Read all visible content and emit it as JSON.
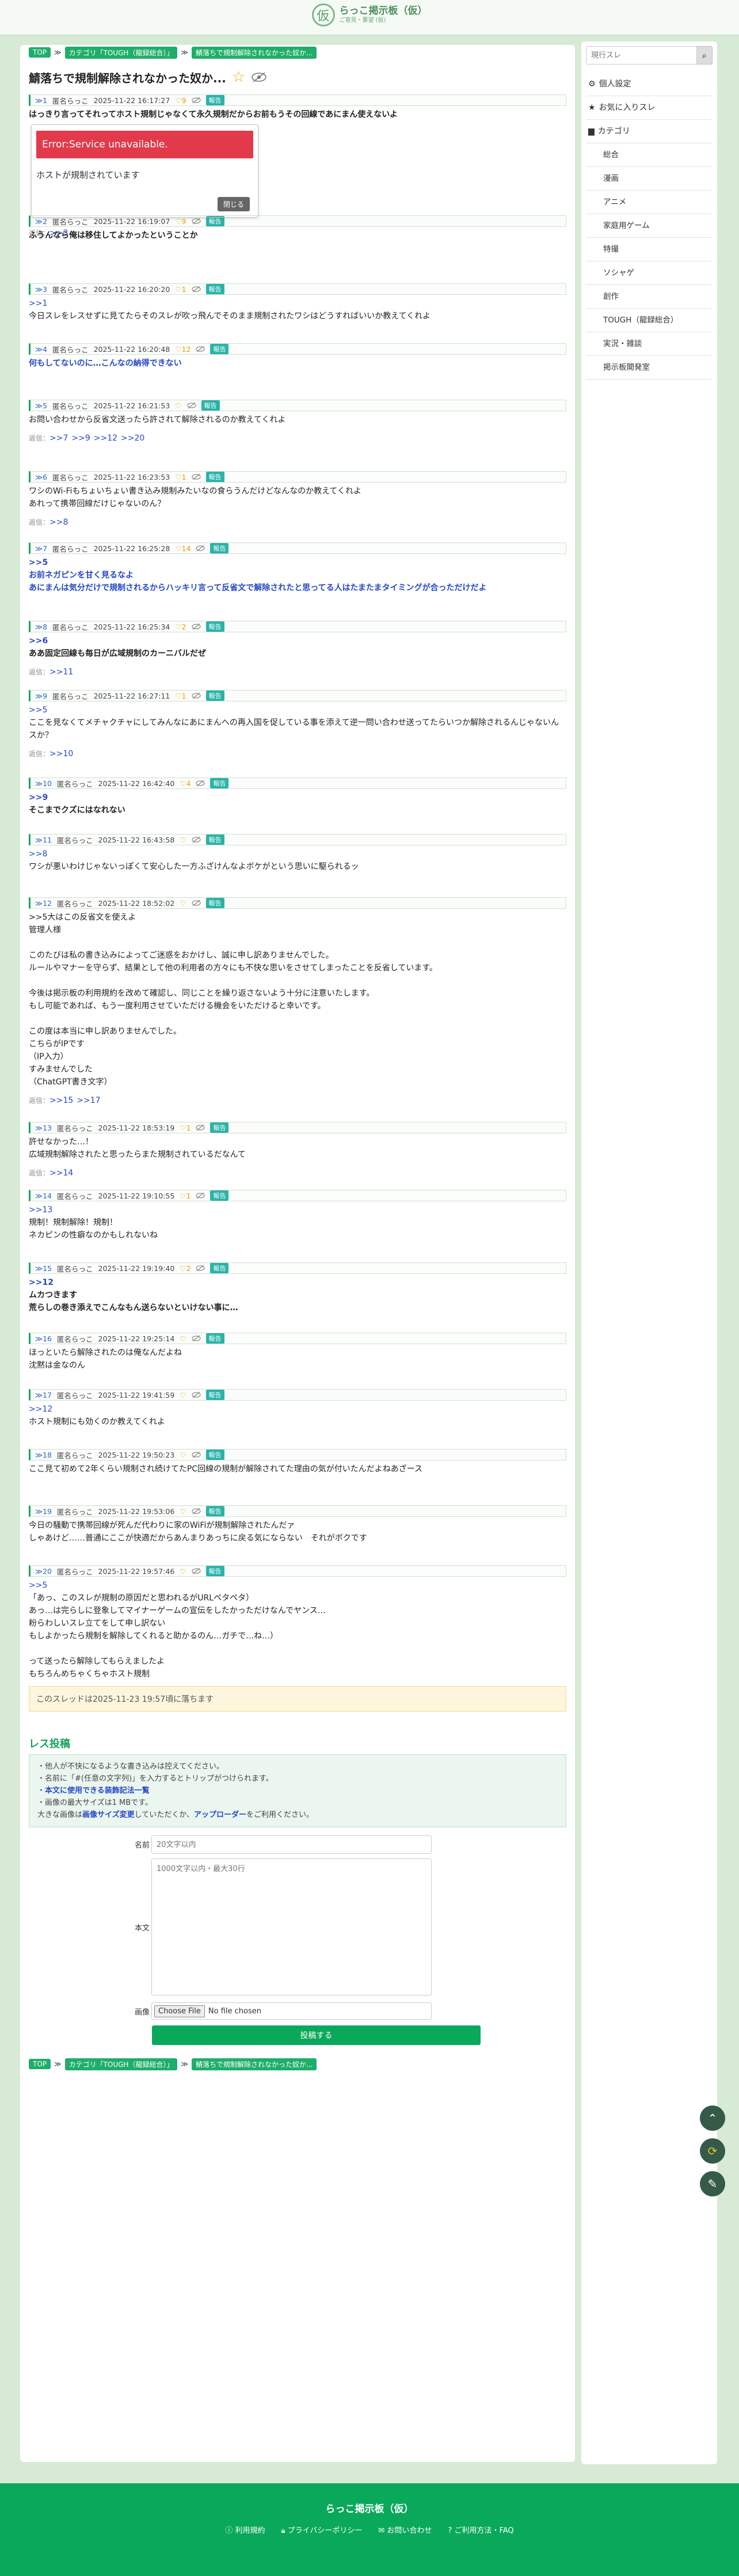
{
  "site": {
    "title": "らっこ掲示板（仮）",
    "sub": "ご意見・要望 (仮)",
    "logo_char": "仮"
  },
  "breadcrumb": [
    "TOP",
    "カテゴリ「TOUGH（龍録総合）」",
    "鯖落ちで規制解除されなかった奴か..."
  ],
  "thread": {
    "title": "鯖落ちで規制解除されなかった奴か..."
  },
  "posts": [
    {
      "no": "≫1",
      "name": "匿名らっこ",
      "date": "2025-11-22 16:17:27",
      "likes": "9",
      "report": "報告",
      "lines": [
        "はっきり言ってそれってホスト規制じゃなくて永久規制だからお前もうその回線であにまん使えないよ"
      ],
      "style": "bold",
      "embed": {
        "error": "Error:Service unavailable.",
        "note": "ホストが規制されています",
        "close": "閉じる"
      },
      "replies_label": "返信：",
      "replies": [
        ">>3"
      ]
    },
    {
      "no": "≫2",
      "name": "匿名らっこ",
      "date": "2025-11-22 16:19:07",
      "likes": "9",
      "report": "報告",
      "lines": [
        "ふうんなら俺は移住してよかったということか"
      ],
      "style": "bold"
    },
    {
      "no": "≫3",
      "name": "匿名らっこ",
      "date": "2025-11-22 16:20:20",
      "likes": "1",
      "report": "報告",
      "lines": [
        ">>1",
        "今日スレをレスせずに見てたらそのスレが吹っ飛んでそのまま規制されたワシはどうすればいいか教えてくれよ"
      ],
      "style": "normal"
    },
    {
      "no": "≫4",
      "name": "匿名らっこ",
      "date": "2025-11-22 16:20:48",
      "likes": "12",
      "report": "報告",
      "lines": [
        "何もしてないのに…こんなの納得できない"
      ],
      "style": "blue"
    },
    {
      "no": "≫5",
      "name": "匿名らっこ",
      "date": "2025-11-22 16:21:53",
      "likes": "",
      "report": "報告",
      "lines": [
        "お問い合わせから反省文送ったら許されて解除されるのか教えてくれよ"
      ],
      "style": "normal",
      "replies_label": "返信：",
      "replies": [
        ">>7",
        ">>9",
        ">>12",
        ">>20"
      ]
    },
    {
      "no": "≫6",
      "name": "匿名らっこ",
      "date": "2025-11-22 16:23:53",
      "likes": "1",
      "report": "報告",
      "lines": [
        "ワシのWi-Fiもちょいちょい書き込み規制みたいなの食らうんだけどなんなのか教えてくれよ",
        "あれって携帯回線だけじゃないのん？"
      ],
      "style": "normal",
      "replies_label": "返信：",
      "replies": [
        ">>8"
      ]
    },
    {
      "no": "≫7",
      "name": "匿名らっこ",
      "date": "2025-11-22 16:25:28",
      "likes": "14",
      "report": "報告",
      "lines": [
        ">>5",
        "お前ネガピンを甘く見るなよ",
        "あにまんは気分だけで規制されるからハッキリ言って反省文で解除されたと思ってる人はたまたまタイミングが合っただけだよ"
      ],
      "style": "blue"
    },
    {
      "no": "≫8",
      "name": "匿名らっこ",
      "date": "2025-11-22 16:25:34",
      "likes": "2",
      "report": "報告",
      "lines": [
        ">>6",
        "ああ固定回線も毎日が広域規制のカーニバルだぜ"
      ],
      "style": "bold",
      "replies_label": "返信：",
      "replies": [
        ">>11"
      ]
    },
    {
      "no": "≫9",
      "name": "匿名らっこ",
      "date": "2025-11-22 16:27:11",
      "likes": "1",
      "report": "報告",
      "lines": [
        ">>5",
        "ここを見なくてメチャクチャにしてみんなにあにまんへの再入国を促している事を添えて逆一問い合わせ送ってたらいつか解除されるんじゃないんスか？"
      ],
      "style": "normal",
      "replies_label": "返信：",
      "replies": [
        ">>10"
      ]
    },
    {
      "no": "≫10",
      "name": "匿名らっこ",
      "date": "2025-11-22 16:42:40",
      "likes": "4",
      "report": "報告",
      "lines": [
        ">>9",
        "そこまでクズにはなれない"
      ],
      "style": "bold"
    },
    {
      "no": "≫11",
      "name": "匿名らっこ",
      "date": "2025-11-22 16:43:58",
      "likes": "",
      "report": "報告",
      "lines": [
        ">>8",
        "ワシが悪いわけじゃないっぽくて安心した一方ふざけんなよボケがという思いに駆られるッ"
      ],
      "style": "normal"
    },
    {
      "no": "≫12",
      "name": "匿名らっこ",
      "date": "2025-11-22 18:52:02",
      "likes": "",
      "report": "報告",
      "lines": [
        ">>5大はこの反省文を使えよ",
        "管理人様",
        "",
        "このたびは私の書き込みによってご迷惑をおかけし、誠に申し訳ありませんでした。",
        "ルールやマナーを守らず、結果として他の利用者の方々にも不快な思いをさせてしまったことを反省しています。",
        "",
        "今後は掲示板の利用規約を改めて確認し、同じことを繰り返さないよう十分に注意いたします。",
        "もし可能であれば、もう一度利用させていただける機会をいただけると幸いです。",
        "",
        "この度は本当に申し訳ありませんでした。",
        "こちらがIPです",
        "（IP入力）",
        "すみませんでした",
        "（ChatGPT書き文字）"
      ],
      "style": "normal",
      "replies_label": "返信：",
      "replies": [
        ">>15",
        ">>17"
      ]
    },
    {
      "no": "≫13",
      "name": "匿名らっこ",
      "date": "2025-11-22 18:53:19",
      "likes": "1",
      "report": "報告",
      "lines": [
        "許せなかった…！",
        "広域規制解除されたと思ったらまた規制されているだなんて"
      ],
      "style": "normal",
      "replies_label": "返信：",
      "replies": [
        ">>14"
      ]
    },
    {
      "no": "≫14",
      "name": "匿名らっこ",
      "date": "2025-11-22 19:10:55",
      "likes": "1",
      "report": "報告",
      "lines": [
        ">>13",
        "規制！規制解除！規制！",
        "ネカピンの性癖なのかもしれないね"
      ],
      "style": "normal"
    },
    {
      "no": "≫15",
      "name": "匿名らっこ",
      "date": "2025-11-22 19:19:40",
      "likes": "2",
      "report": "報告",
      "lines": [
        ">>12",
        "ムカつきます",
        "荒らしの巻き添えでこんなもん送らないといけない事に…"
      ],
      "style": "bold"
    },
    {
      "no": "≫16",
      "name": "匿名らっこ",
      "date": "2025-11-22 19:25:14",
      "likes": "",
      "report": "報告",
      "lines": [
        "ほっといたら解除されたのは俺なんだよね",
        "沈黙は金なのん"
      ],
      "style": "normal"
    },
    {
      "no": "≫17",
      "name": "匿名らっこ",
      "date": "2025-11-22 19:41:59",
      "likes": "",
      "report": "報告",
      "lines": [
        ">>12",
        "ホスト規制にも効くのか教えてくれよ"
      ],
      "style": "normal"
    },
    {
      "no": "≫18",
      "name": "匿名らっこ",
      "date": "2025-11-22 19:50:23",
      "likes": "",
      "report": "報告",
      "lines": [
        "ここ見て初めて2年くらい規制され続けてたPC回線の規制が解除されてた理由の気が付いたんだよねあざース"
      ],
      "style": "normal"
    },
    {
      "no": "≫19",
      "name": "匿名らっこ",
      "date": "2025-11-22 19:53:06",
      "likes": "",
      "report": "報告",
      "lines": [
        "今日の騒動で携帯回線が死んだ代わりに家のWiFiが規制解除されたんだァ",
        "しゃあけど……普通にここが快適だからあんまりあっちに戻る気にならない　それがボクです"
      ],
      "style": "normal"
    },
    {
      "no": "≫20",
      "name": "匿名らっこ",
      "date": "2025-11-22 19:57:46",
      "likes": "",
      "report": "報告",
      "lines": [
        ">>5",
        "「あっ、このスレが規制の原因だと思われるがURLペタペタ）",
        "あっ…は完らしに登象してマイナーゲームの宣伝をしたかっただけなんでヤンス…",
        "粉らわしいスレ立てをして申し訳ない",
        "もしよかったら規制を解除してくれると助かるのん…ガチで…ね…）",
        "",
        "って送ったら解除してもらえましたよ",
        "もちろんめちゃくちゃホスト規制"
      ],
      "style": "normal"
    }
  ],
  "expire_notice": "このスレッドは2025-11-23 19:57頃に落ちます",
  "form": {
    "title": "レス投稿",
    "notices": [
      "他人が不快になるような書き込みは控えてください。",
      "名前に「#(任意の文字列)」を入力するとトリップがつけられます。",
      "本文に使用できる装飾記法一覧",
      "画像の最大サイズは1 MBです。"
    ],
    "notice_tail_a": "大きな画像は",
    "notice_link_1": "画像サイズ変更",
    "notice_tail_b": "していただくか、",
    "notice_link_2": "アップローダー",
    "notice_tail_c": "をご利用ください。",
    "name_label": "名前",
    "name_placeholder": "20文字以内",
    "body_label": "本文",
    "body_placeholder": "1000文字以内・最大30行",
    "image_label": "画像",
    "file_button": "Choose File",
    "file_status": "No file chosen",
    "submit": "投稿する"
  },
  "sidebar": {
    "search_placeholder": "現行スレ",
    "items": [
      {
        "label": "個人設定",
        "icon": "gear-icon",
        "sub": false
      },
      {
        "label": "お気に入りスレ",
        "icon": "star-icon",
        "sub": false
      },
      {
        "label": "カテゴリ",
        "icon": "folder-icon",
        "sub": false
      },
      {
        "label": "総合",
        "sub": true
      },
      {
        "label": "漫画",
        "sub": true
      },
      {
        "label": "アニメ",
        "sub": true
      },
      {
        "label": "家庭用ゲーム",
        "sub": true
      },
      {
        "label": "特撮",
        "sub": true
      },
      {
        "label": "ソシャゲ",
        "sub": true
      },
      {
        "label": "創作",
        "sub": true
      },
      {
        "label": "TOUGH（龍録総合）",
        "sub": true
      },
      {
        "label": "実況・雑談",
        "sub": true
      },
      {
        "label": "掲示板開発室",
        "sub": true
      }
    ]
  },
  "footer": {
    "title": "らっこ掲示板（仮）",
    "links": [
      "利用規約",
      "プライバシーポリシー",
      "お問い合わせ",
      "ご利用方法・FAQ"
    ]
  },
  "colors": {
    "accent": "#0aa85a",
    "link": "#2647c9",
    "error": "#e23a4b"
  }
}
